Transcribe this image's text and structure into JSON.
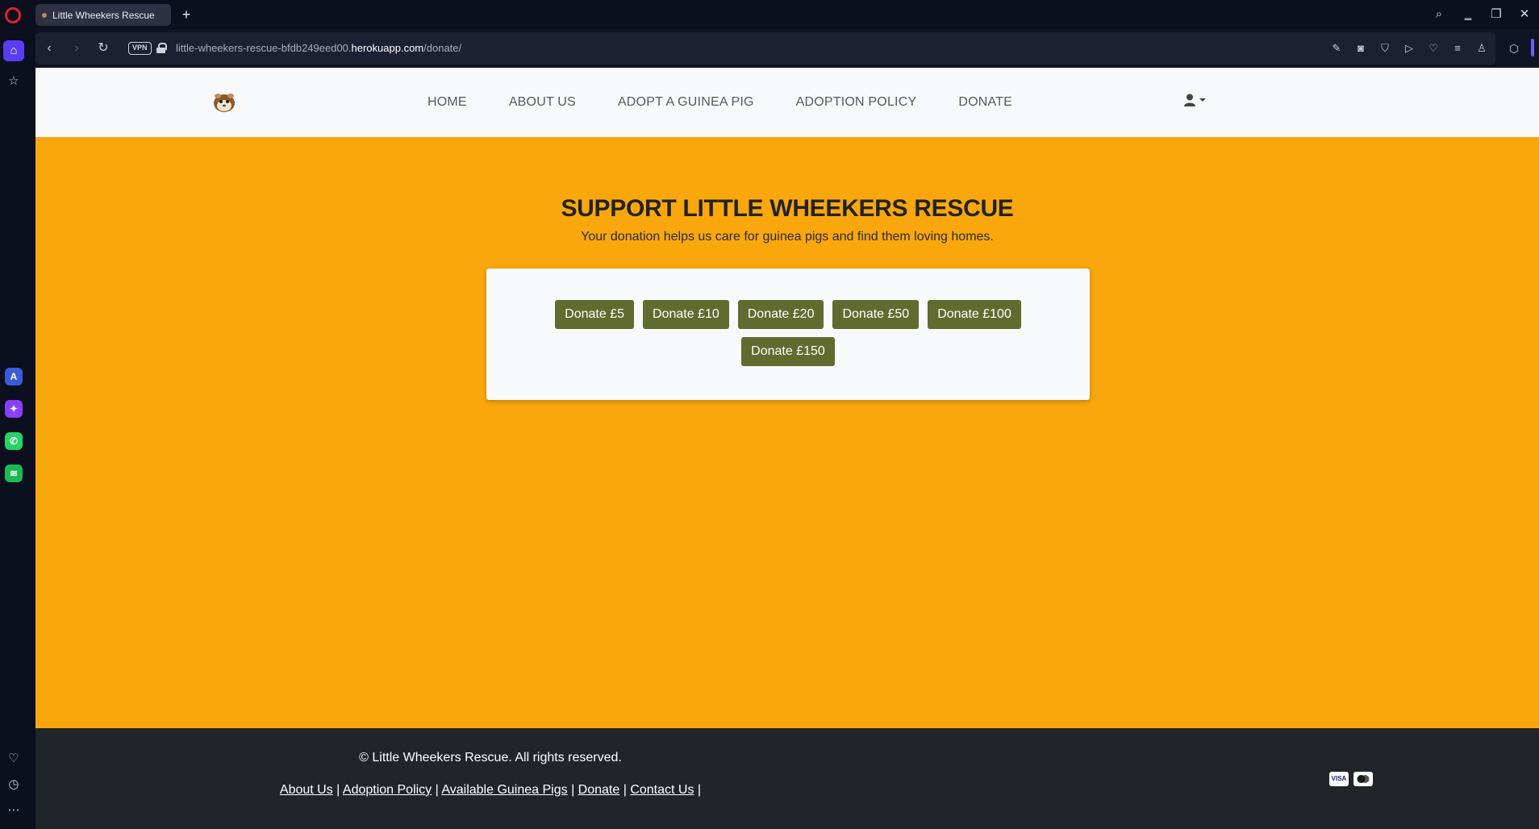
{
  "browser": {
    "tab_title": "Little Wheekers Rescue",
    "new_tab_icon": "+",
    "url_prefix": "little-wheekers-rescue-bfdb249eed00.",
    "url_domain": "herokuapp.com",
    "url_path": "/donate/",
    "vpn_label": "VPN"
  },
  "navbar": {
    "links": [
      "HOME",
      "ABOUT US",
      "ADOPT A GUINEA PIG",
      "ADOPTION POLICY",
      "DONATE"
    ]
  },
  "hero": {
    "title": "SUPPORT LITTLE WHEEKERS RESCUE",
    "subtitle": "Your donation helps us care for guinea pigs and find them loving homes."
  },
  "donate": {
    "buttons": [
      "Donate £5",
      "Donate £10",
      "Donate £20",
      "Donate £50",
      "Donate £100",
      "Donate £150"
    ]
  },
  "footer": {
    "copyright": "© Little Wheekers Rescue. All rights reserved.",
    "links": [
      "About Us",
      "Adoption Policy",
      "Available Guinea Pigs",
      "Donate",
      "Contact Us"
    ],
    "separator": "|",
    "payment_icons": [
      "visa-icon",
      "mastercard-icon"
    ],
    "visa_label": "VISA"
  },
  "colors": {
    "page_background": "#f9a70d",
    "button": "#626b2f",
    "footer": "#21252a",
    "navbar": "#f8f9fa"
  }
}
